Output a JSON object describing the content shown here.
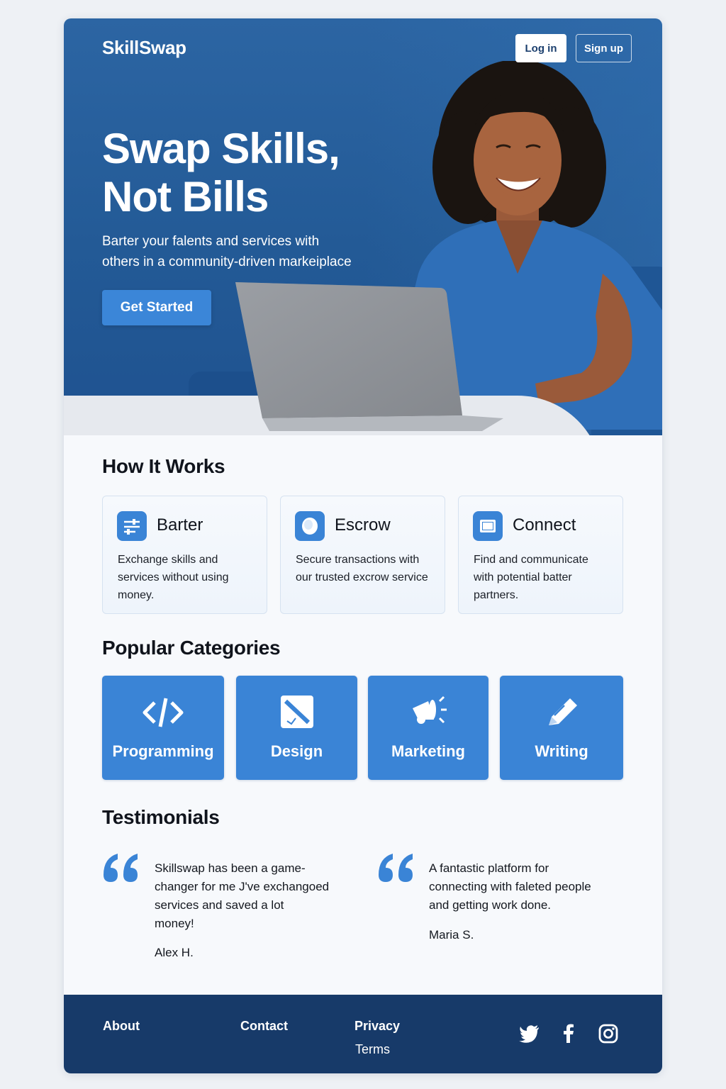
{
  "header": {
    "brand": "SkillSwap",
    "login_label": "Log in",
    "signup_label": "Sign up"
  },
  "hero": {
    "title_line1": "Swap Skills,",
    "title_line2": "Not Bills",
    "subtitle_line1": "Barter your falents and services with",
    "subtitle_line2": "others in a community-driven markeiplace",
    "cta_label": "Get Started"
  },
  "how_it_works": {
    "title": "How It Works",
    "cards": [
      {
        "icon": "barter-sliders-icon",
        "title": "Barter",
        "desc_lines": [
          "Exchange skills and",
          "services without using",
          "money."
        ]
      },
      {
        "icon": "escrow-shield-icon",
        "title": "Escrow",
        "desc_lines": [
          "Secure transactions with",
          "our trusted excrow service",
          ""
        ]
      },
      {
        "icon": "connect-window-icon",
        "title": "Connect",
        "desc_lines": [
          "Find and communicate",
          "with potential batter",
          "partners."
        ]
      }
    ]
  },
  "categories": {
    "title": "Popular Categories",
    "items": [
      {
        "icon": "code-icon",
        "label": "Programming"
      },
      {
        "icon": "pen-design-icon",
        "label": "Design"
      },
      {
        "icon": "megaphone-icon",
        "label": "Marketing"
      },
      {
        "icon": "pencil-icon",
        "label": "Writing"
      }
    ]
  },
  "testimonials": {
    "title": "Testimonials",
    "items": [
      {
        "lines": [
          "Skillswap has been a game-",
          "changer for me J've exchangoed",
          "services and saved a lot",
          "money!"
        ],
        "author": "Alex H."
      },
      {
        "lines": [
          "A fantastic platform for",
          "connecting with faleted people",
          "and getting work done."
        ],
        "author": "Maria S."
      }
    ]
  },
  "footer": {
    "about": "About",
    "contact": "Contact",
    "privacy": "Privacy",
    "terms": "Terms",
    "social": [
      "twitter-icon",
      "facebook-icon",
      "instagram-icon"
    ]
  },
  "colors": {
    "primary": "#3a84d6",
    "hero_bg": "#2a63a1",
    "footer_bg": "#173a69"
  }
}
